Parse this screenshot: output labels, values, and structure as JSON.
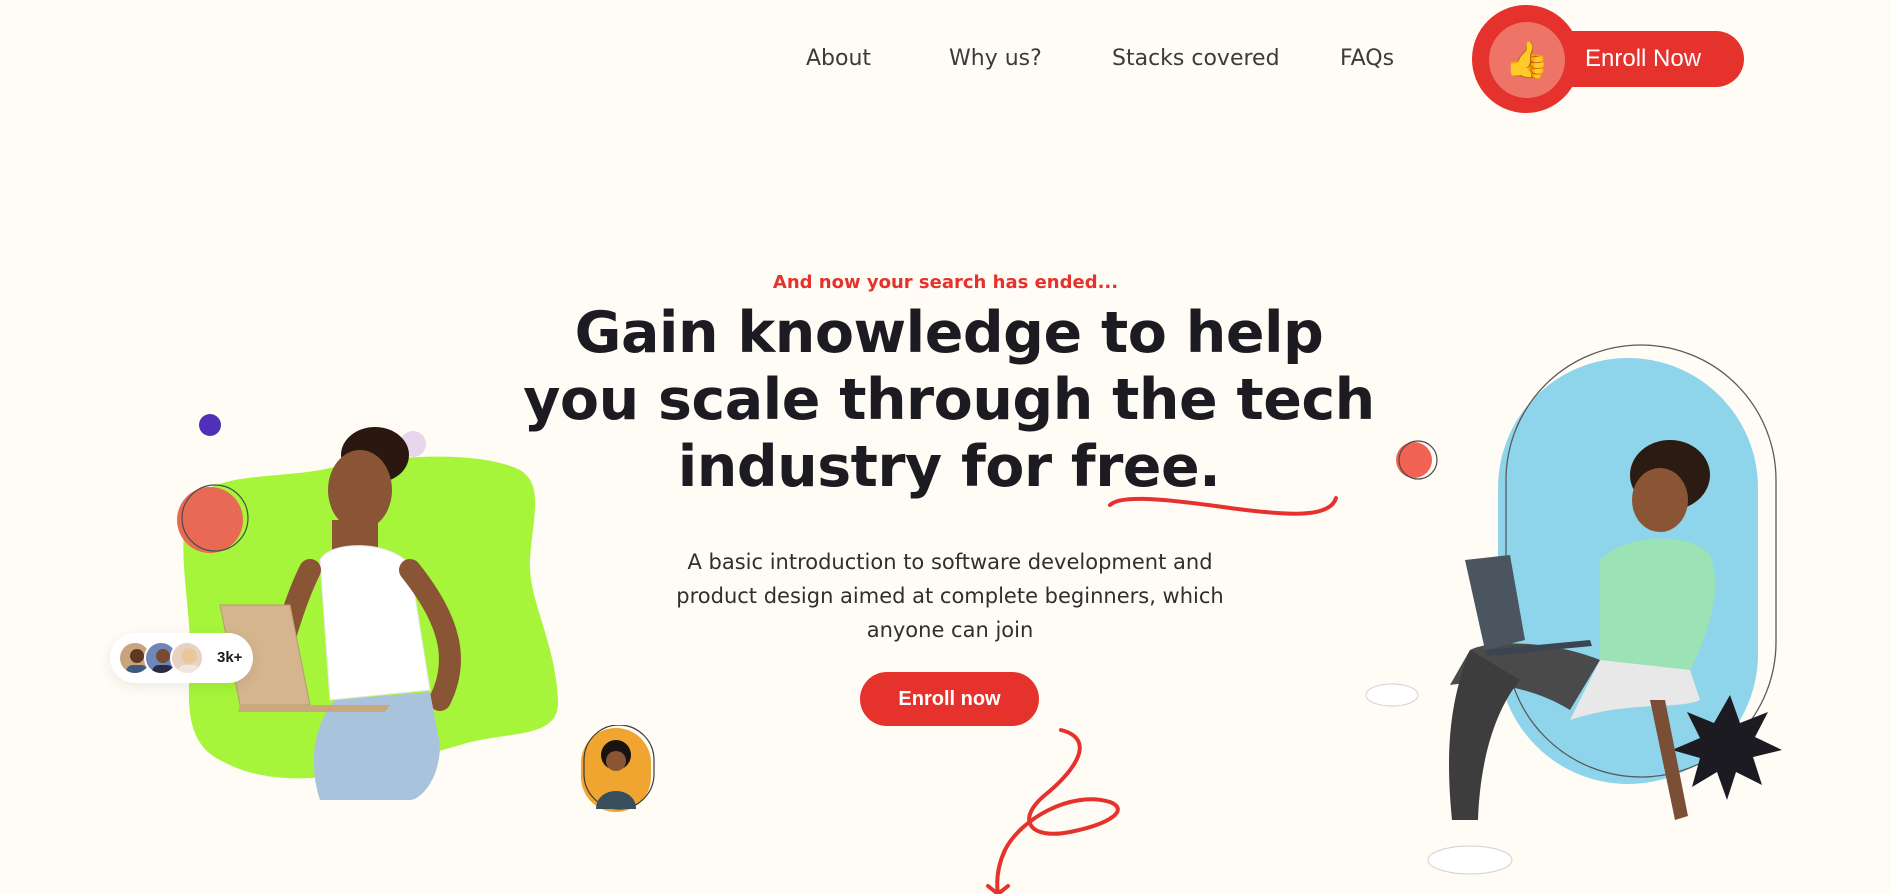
{
  "nav": {
    "links": [
      {
        "label": "About"
      },
      {
        "label": "Why us?"
      },
      {
        "label": "Stacks covered"
      },
      {
        "label": "FAQs"
      }
    ],
    "cta_label": "Enroll Now",
    "cta_icon": "👍"
  },
  "hero": {
    "eyebrow": "And now your search has ended...",
    "headline": "Gain knowledge to help you scale through the tech industry for free.",
    "subtext": "A basic introduction to software development and product design aimed at complete beginners, which anyone can join",
    "cta_label": "Enroll now"
  },
  "community_badge": {
    "count": "3k+"
  },
  "colors": {
    "accent": "#e5322d",
    "background": "#fffcf5",
    "lime": "#a6f53a",
    "sky": "#8ed5ec",
    "dark": "#1d1b22",
    "purple": "#5030b8",
    "orange": "#f0a531"
  }
}
